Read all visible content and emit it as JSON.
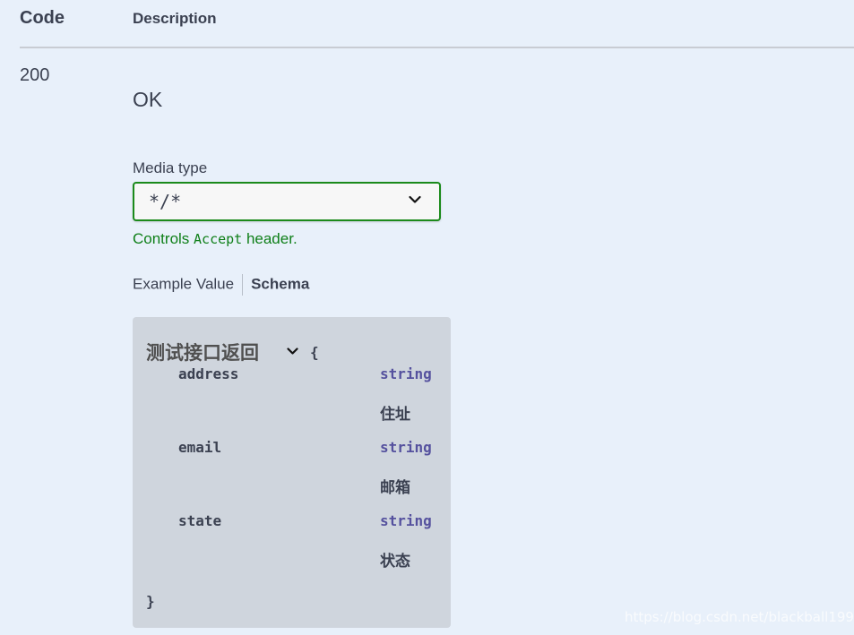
{
  "header": {
    "code": "Code",
    "description": "Description"
  },
  "response": {
    "code": "200",
    "description": "OK",
    "media_type_label": "Media type",
    "media_type_value": "*/*",
    "controls_prefix": "Controls ",
    "controls_code": "Accept",
    "controls_suffix": " header."
  },
  "tabs": {
    "example": "Example Value",
    "schema": "Schema"
  },
  "schema": {
    "title": "测试接口返回",
    "open": "{",
    "close": "}",
    "properties": [
      {
        "name": "address",
        "type": "string",
        "description": "住址"
      },
      {
        "name": "email",
        "type": "string",
        "description": "邮箱"
      },
      {
        "name": "state",
        "type": "string",
        "description": "状态"
      }
    ]
  },
  "watermark": "https://blog.csdn.net/blackball1998",
  "colors": {
    "background": "#e8f0fa",
    "accent_green": "#1b8a1b",
    "type_purple": "#55519e"
  },
  "icons": {
    "select_chevron": "chevron-down-icon",
    "model_toggle": "chevron-down-icon"
  }
}
